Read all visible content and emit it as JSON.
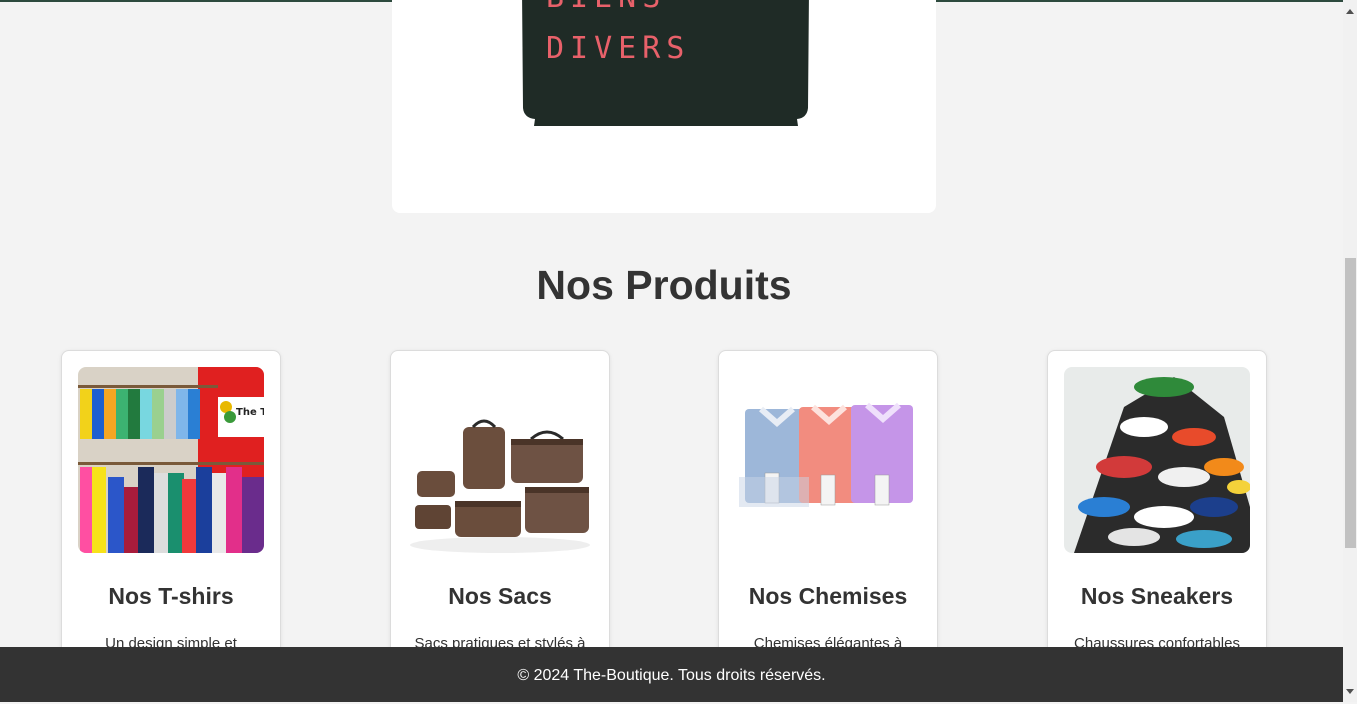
{
  "hero": {
    "bag_text": [
      "BIENS",
      "DIVERS"
    ],
    "bag_color": "#1f2b26",
    "text_color": "#e8616a"
  },
  "products": {
    "title": "Nos Produits",
    "items": [
      {
        "title": "Nos T-shirs",
        "desc": "Un design simple et",
        "image": "tshirt-shop-photo"
      },
      {
        "title": "Nos Sacs",
        "desc": "Sacs pratiques et stylés à",
        "image": "bags-photo"
      },
      {
        "title": "Nos Chemises",
        "desc": "Chemises élégantes à",
        "image": "shirts-photo"
      },
      {
        "title": "Nos Sneakers",
        "desc": "Chaussures confortables",
        "image": "sneakers-photo"
      }
    ]
  },
  "footer": {
    "text": "© 2024 The-Boutique. Tous droits réservés."
  },
  "colors": {
    "page_bg": "#f3f3f3",
    "footer_bg": "#333333",
    "text": "#333333"
  }
}
